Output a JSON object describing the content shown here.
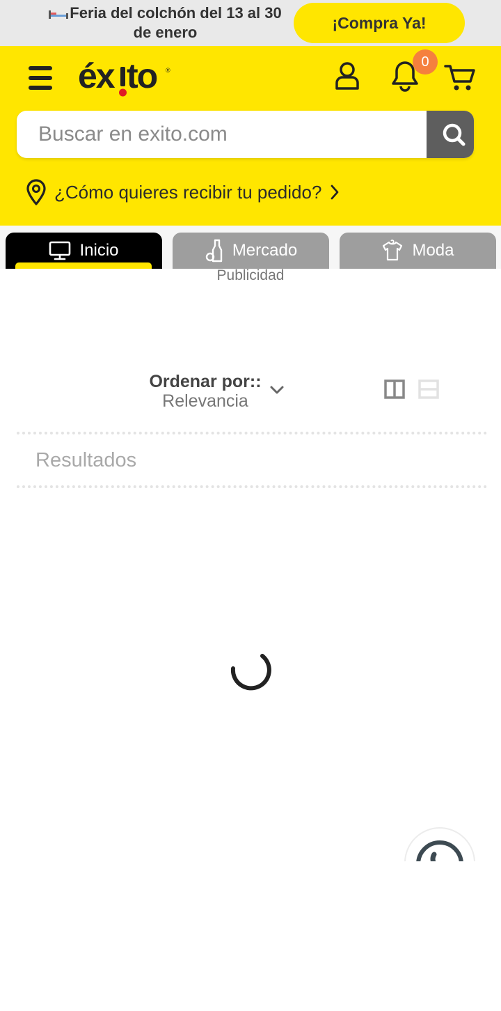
{
  "promo": {
    "text": "Feria del colchón del 13 al 30 de enero",
    "button_label": "¡Compra Ya!"
  },
  "header": {
    "logo_text": "éxito",
    "cart_count": "0",
    "search_placeholder": "Buscar en exito.com",
    "delivery_text": "¿Cómo quieres recibir tu pedido?"
  },
  "tabs": [
    {
      "label": "Inicio",
      "icon": "monitor-icon",
      "active": true
    },
    {
      "label": "Mercado",
      "icon": "bottle-icon",
      "active": false
    },
    {
      "label": "Moda",
      "icon": "shirt-icon",
      "active": false
    }
  ],
  "ad_label": "Publicidad",
  "sort": {
    "title": "Ordenar por::",
    "value": "Relevancia"
  },
  "results_label": "Resultados",
  "colors": {
    "brand_yellow": "#ffe600",
    "badge_orange": "#f5803e",
    "search_button": "#5e5e5e",
    "inactive_tab": "#9e9e9e"
  }
}
